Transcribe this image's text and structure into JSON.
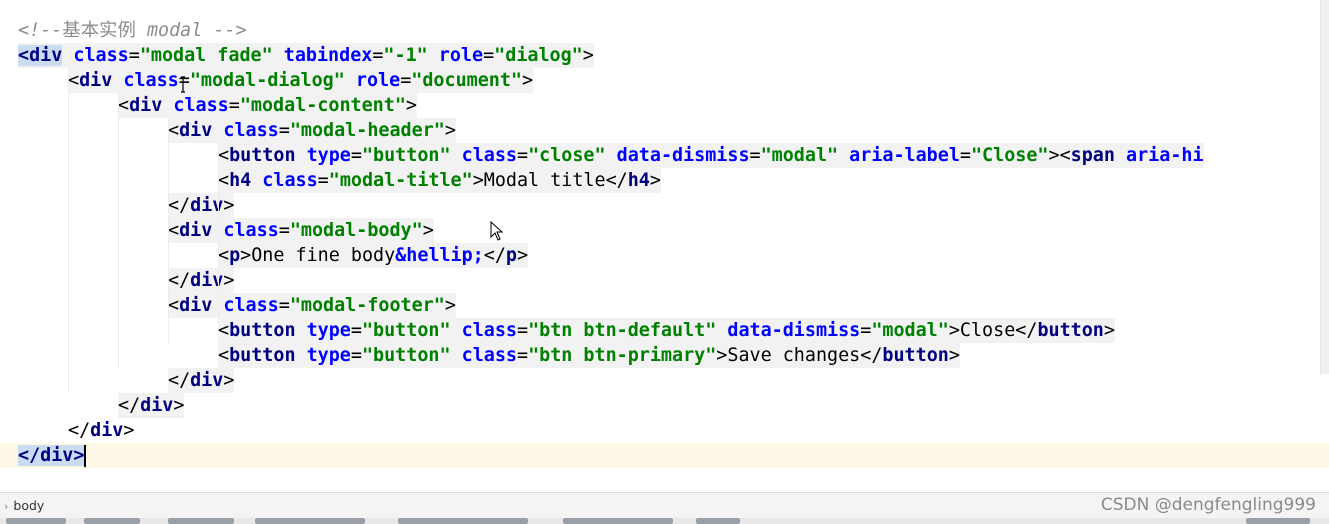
{
  "editor": {
    "lines": [
      [
        {
          "c": "comment",
          "t": "<!--"
        },
        {
          "c": "comment cjk",
          "t": "基本实例"
        },
        {
          "c": "comment",
          "t": " modal -->"
        }
      ],
      [
        {
          "c": "tag tag-sel",
          "t": "<div"
        },
        {
          "c": "attr",
          "t": " class"
        },
        {
          "c": "punc",
          "t": "="
        },
        {
          "c": "str",
          "t": "\"modal fade\""
        },
        {
          "c": "attr",
          "t": " tabindex"
        },
        {
          "c": "punc",
          "t": "="
        },
        {
          "c": "str",
          "t": "\"-1\""
        },
        {
          "c": "attr",
          "t": " role"
        },
        {
          "c": "punc",
          "t": "="
        },
        {
          "c": "str",
          "t": "\"dialog\""
        },
        {
          "c": "punc",
          "t": ">"
        }
      ],
      [
        {
          "c": "punc",
          "t": "<"
        },
        {
          "c": "tag",
          "t": "div"
        },
        {
          "c": "attr",
          "t": " class"
        },
        {
          "c": "punc",
          "t": "="
        },
        {
          "c": "str",
          "t": "\"modal-dialog\""
        },
        {
          "c": "attr",
          "t": " role"
        },
        {
          "c": "punc",
          "t": "="
        },
        {
          "c": "str",
          "t": "\"document\""
        },
        {
          "c": "punc",
          "t": ">"
        }
      ],
      [
        {
          "c": "punc",
          "t": "<"
        },
        {
          "c": "tag",
          "t": "div"
        },
        {
          "c": "attr",
          "t": " class"
        },
        {
          "c": "punc",
          "t": "="
        },
        {
          "c": "str",
          "t": "\"modal-content\""
        },
        {
          "c": "punc",
          "t": ">"
        }
      ],
      [
        {
          "c": "punc",
          "t": "<"
        },
        {
          "c": "tag",
          "t": "div"
        },
        {
          "c": "attr",
          "t": " class"
        },
        {
          "c": "punc",
          "t": "="
        },
        {
          "c": "str",
          "t": "\"modal-header\""
        },
        {
          "c": "punc",
          "t": ">"
        }
      ],
      [
        {
          "c": "punc",
          "t": "<"
        },
        {
          "c": "tag",
          "t": "button"
        },
        {
          "c": "attr",
          "t": " type"
        },
        {
          "c": "punc",
          "t": "="
        },
        {
          "c": "str",
          "t": "\"button\""
        },
        {
          "c": "attr",
          "t": " class"
        },
        {
          "c": "punc",
          "t": "="
        },
        {
          "c": "str",
          "t": "\"close\""
        },
        {
          "c": "attr",
          "t": " data-dismiss"
        },
        {
          "c": "punc",
          "t": "="
        },
        {
          "c": "str",
          "t": "\"modal\""
        },
        {
          "c": "attr",
          "t": " aria-label"
        },
        {
          "c": "punc",
          "t": "="
        },
        {
          "c": "str",
          "t": "\"Close\""
        },
        {
          "c": "punc",
          "t": "><"
        },
        {
          "c": "tag",
          "t": "span"
        },
        {
          "c": "attr",
          "t": " aria-hi"
        }
      ],
      [
        {
          "c": "punc",
          "t": "<"
        },
        {
          "c": "tag",
          "t": "h4"
        },
        {
          "c": "attr",
          "t": " class"
        },
        {
          "c": "punc",
          "t": "="
        },
        {
          "c": "str",
          "t": "\"modal-title\""
        },
        {
          "c": "punc",
          "t": ">"
        },
        {
          "c": "text",
          "t": "Modal title"
        },
        {
          "c": "punc",
          "t": "</"
        },
        {
          "c": "tag",
          "t": "h4"
        },
        {
          "c": "punc",
          "t": ">"
        }
      ],
      [
        {
          "c": "punc",
          "t": "</"
        },
        {
          "c": "tag",
          "t": "div"
        },
        {
          "c": "punc",
          "t": ">"
        }
      ],
      [
        {
          "c": "punc",
          "t": "<"
        },
        {
          "c": "tag",
          "t": "div"
        },
        {
          "c": "attr",
          "t": " class"
        },
        {
          "c": "punc",
          "t": "="
        },
        {
          "c": "str",
          "t": "\"modal-body\""
        },
        {
          "c": "punc",
          "t": ">"
        }
      ],
      [
        {
          "c": "punc",
          "t": "<"
        },
        {
          "c": "tag",
          "t": "p"
        },
        {
          "c": "punc",
          "t": ">"
        },
        {
          "c": "text",
          "t": "One fine body"
        },
        {
          "c": "entity",
          "t": "&hellip;"
        },
        {
          "c": "punc",
          "t": "</"
        },
        {
          "c": "tag",
          "t": "p"
        },
        {
          "c": "punc",
          "t": ">"
        }
      ],
      [
        {
          "c": "punc",
          "t": "</"
        },
        {
          "c": "tag",
          "t": "div"
        },
        {
          "c": "punc",
          "t": ">"
        }
      ],
      [
        {
          "c": "punc",
          "t": "<"
        },
        {
          "c": "tag",
          "t": "div"
        },
        {
          "c": "attr",
          "t": " class"
        },
        {
          "c": "punc",
          "t": "="
        },
        {
          "c": "str",
          "t": "\"modal-footer\""
        },
        {
          "c": "punc",
          "t": ">"
        }
      ],
      [
        {
          "c": "punc",
          "t": "<"
        },
        {
          "c": "tag",
          "t": "button"
        },
        {
          "c": "attr",
          "t": " type"
        },
        {
          "c": "punc",
          "t": "="
        },
        {
          "c": "str",
          "t": "\"button\""
        },
        {
          "c": "attr",
          "t": " class"
        },
        {
          "c": "punc",
          "t": "="
        },
        {
          "c": "str",
          "t": "\"btn btn-default\""
        },
        {
          "c": "attr",
          "t": " data-dismiss"
        },
        {
          "c": "punc",
          "t": "="
        },
        {
          "c": "str",
          "t": "\"modal\""
        },
        {
          "c": "punc",
          "t": ">"
        },
        {
          "c": "text",
          "t": "Close"
        },
        {
          "c": "punc",
          "t": "</"
        },
        {
          "c": "tag",
          "t": "button"
        },
        {
          "c": "punc",
          "t": ">"
        }
      ],
      [
        {
          "c": "punc",
          "t": "<"
        },
        {
          "c": "tag",
          "t": "button"
        },
        {
          "c": "attr",
          "t": " type"
        },
        {
          "c": "punc",
          "t": "="
        },
        {
          "c": "str",
          "t": "\"button\""
        },
        {
          "c": "attr",
          "t": " class"
        },
        {
          "c": "punc",
          "t": "="
        },
        {
          "c": "str",
          "t": "\"btn btn-primary\""
        },
        {
          "c": "punc",
          "t": ">"
        },
        {
          "c": "text",
          "t": "Save changes"
        },
        {
          "c": "punc",
          "t": "</"
        },
        {
          "c": "tag",
          "t": "button"
        },
        {
          "c": "punc",
          "t": ">"
        }
      ],
      [
        {
          "c": "punc",
          "t": "</"
        },
        {
          "c": "tag",
          "t": "div"
        },
        {
          "c": "punc",
          "t": ">"
        }
      ],
      [
        {
          "c": "punc",
          "t": "</"
        },
        {
          "c": "tag",
          "t": "div"
        },
        {
          "c": "punc",
          "t": ">"
        }
      ],
      [
        {
          "c": "punc",
          "t": "</"
        },
        {
          "c": "tag",
          "t": "div"
        },
        {
          "c": "punc",
          "t": ">"
        }
      ],
      [
        {
          "c": "tag tag-sel",
          "t": "</div>"
        }
      ]
    ],
    "indent_levels": [
      0,
      0,
      1,
      2,
      3,
      4,
      4,
      3,
      3,
      4,
      3,
      3,
      4,
      4,
      3,
      2,
      1,
      0
    ],
    "current_line": 18
  },
  "statusbar": {
    "breadcrumb": "body",
    "watermark": "CSDN @dengfengling999"
  },
  "colors": {
    "tag": "#000080",
    "attribute": "#0000ff",
    "string": "#008000",
    "comment": "#8c8c8c",
    "current_line_bg": "#fdf9e6"
  }
}
